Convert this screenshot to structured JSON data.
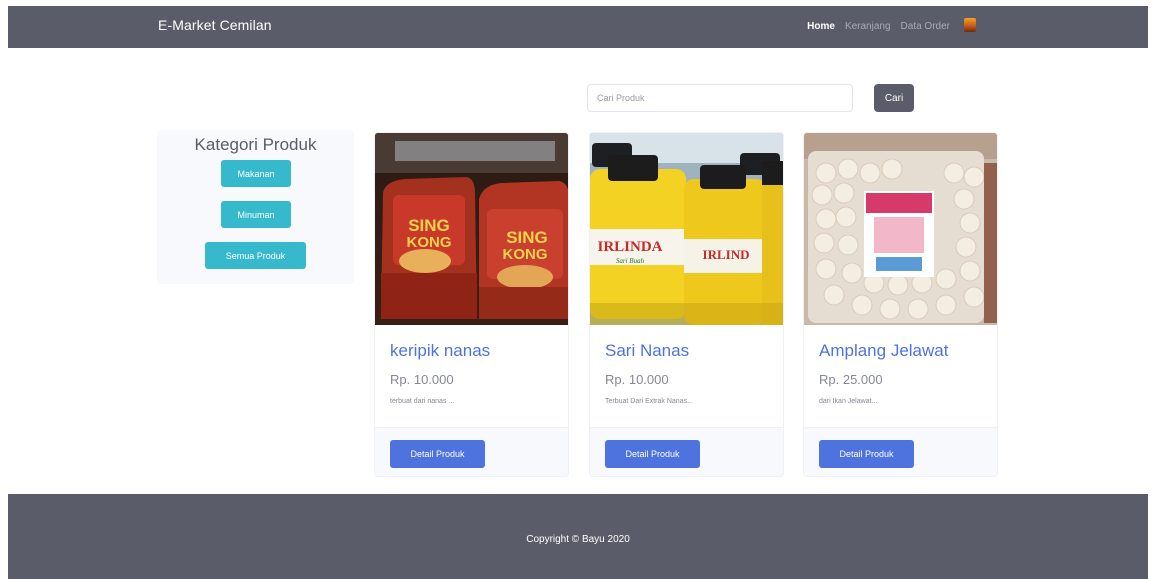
{
  "navbar": {
    "brand": "E-Market Cemilan",
    "links": [
      {
        "label": "Home",
        "active": true
      },
      {
        "label": "Keranjang",
        "active": false
      },
      {
        "label": "Data Order",
        "active": false
      }
    ]
  },
  "search": {
    "placeholder": "Cari Produk",
    "button_label": "Cari"
  },
  "categories": {
    "title": "Kategori Produk",
    "items": [
      {
        "label": "Makanan"
      },
      {
        "label": "Minuman"
      },
      {
        "label": "Semua Produk"
      }
    ]
  },
  "products": [
    {
      "title": "keripik nanas",
      "price": "Rp. 10.000",
      "description": "terbuat dari nanas ...",
      "button_label": "Detail Produk"
    },
    {
      "title": "Sari Nanas",
      "price": "Rp. 10.000",
      "description": "Terbuat Dari Extrak Nanas...",
      "button_label": "Detail Produk"
    },
    {
      "title": "Amplang Jelawat",
      "price": "Rp. 25.000",
      "description": "dari Ikan Jelawat...",
      "button_label": "Detail Produk"
    }
  ],
  "footer": {
    "copyright": "Copyright © Bayu 2020"
  },
  "colors": {
    "navbar": "#5a5c69",
    "primary": "#4e73df",
    "info": "#36b9cc",
    "text_muted": "#858796"
  }
}
